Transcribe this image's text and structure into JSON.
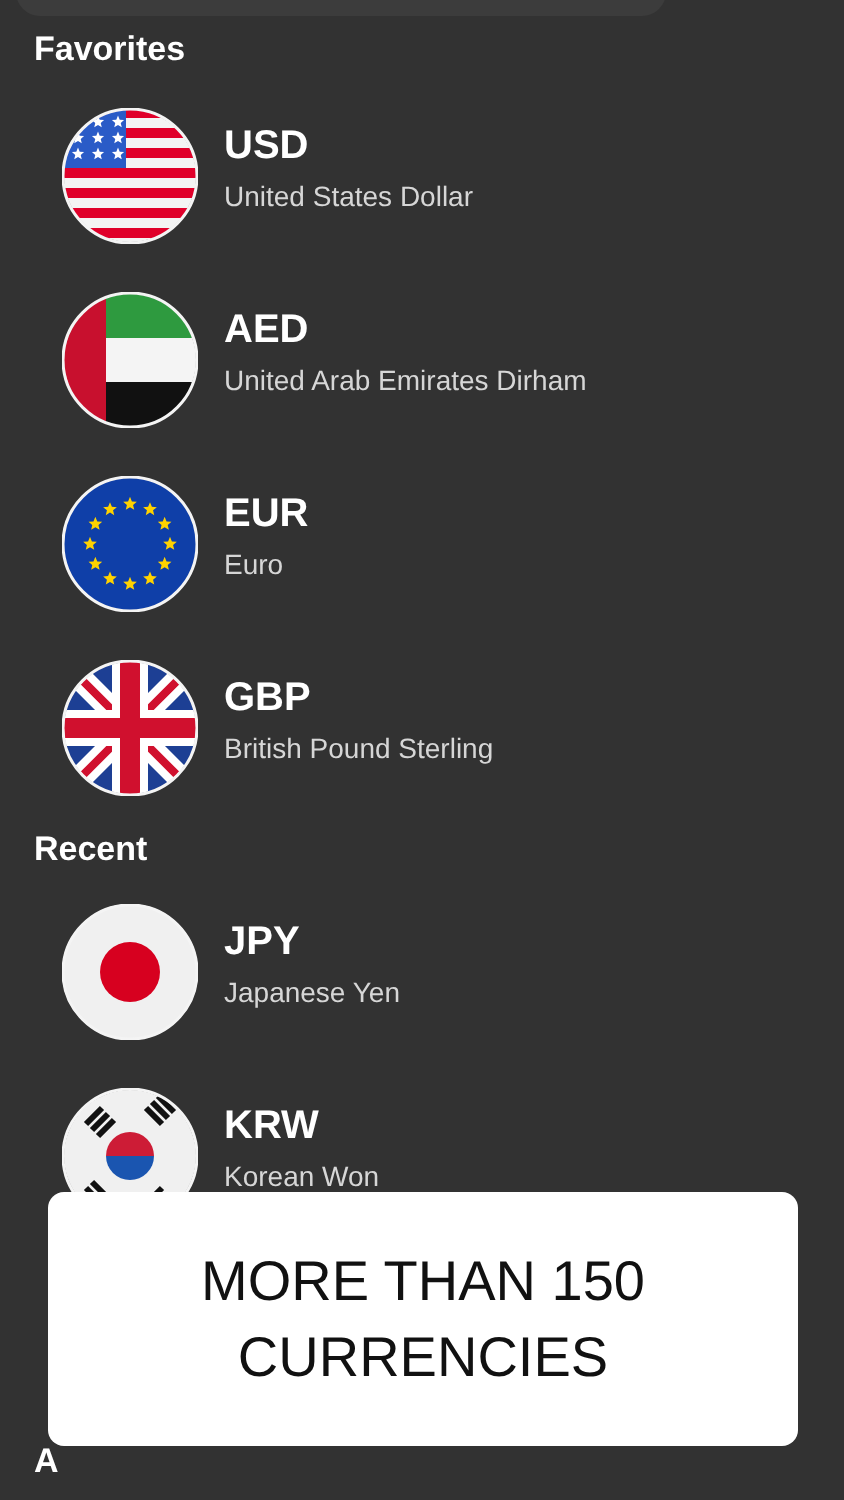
{
  "sections": [
    {
      "title": "Favorites",
      "items": [
        {
          "code": "USD",
          "name": "United States Dollar"
        },
        {
          "code": "AED",
          "name": "United Arab Emirates Dirham"
        },
        {
          "code": "EUR",
          "name": "Euro"
        },
        {
          "code": "GBP",
          "name": "British Pound Sterling"
        }
      ]
    },
    {
      "title": "Recent",
      "items": [
        {
          "code": "JPY",
          "name": "Japanese Yen"
        },
        {
          "code": "KRW",
          "name": "Korean Won"
        }
      ]
    },
    {
      "title": "A"
    }
  ],
  "banner": {
    "text": "MORE THAN 150 CURRENCIES"
  }
}
